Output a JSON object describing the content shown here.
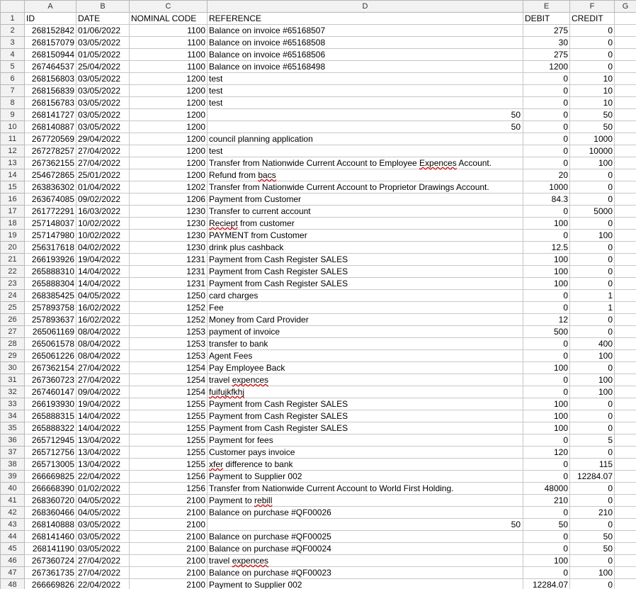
{
  "columns": [
    "A",
    "B",
    "C",
    "D",
    "E",
    "F",
    "G"
  ],
  "headers": {
    "id": "ID",
    "date": "DATE",
    "code": "NOMINAL CODE",
    "ref": "REFERENCE",
    "debit": "DEBIT",
    "credit": "CREDIT"
  },
  "rows": [
    {
      "n": "2",
      "id": "268152842",
      "date": "01/06/2022",
      "code": "1100",
      "ref": "Balance on invoice #65168507",
      "debit": "275",
      "credit": "0"
    },
    {
      "n": "3",
      "id": "268157079",
      "date": "03/05/2022",
      "code": "1100",
      "ref": "Balance on invoice #65168508",
      "debit": "30",
      "credit": "0"
    },
    {
      "n": "4",
      "id": "268150944",
      "date": "01/05/2022",
      "code": "1100",
      "ref": "Balance on invoice #65168506",
      "debit": "275",
      "credit": "0"
    },
    {
      "n": "5",
      "id": "267464537",
      "date": "25/04/2022",
      "code": "1100",
      "ref": "Balance on invoice #65168498",
      "debit": "1200",
      "credit": "0"
    },
    {
      "n": "6",
      "id": "268156803",
      "date": "03/05/2022",
      "code": "1200",
      "ref": "test",
      "debit": "0",
      "credit": "10"
    },
    {
      "n": "7",
      "id": "268156839",
      "date": "03/05/2022",
      "code": "1200",
      "ref": "test",
      "debit": "0",
      "credit": "10"
    },
    {
      "n": "8",
      "id": "268156783",
      "date": "03/05/2022",
      "code": "1200",
      "ref": "test",
      "debit": "0",
      "credit": "10"
    },
    {
      "n": "9",
      "id": "268141727",
      "date": "03/05/2022",
      "code": "1200",
      "ref": "",
      "refnum": "50",
      "debit": "0",
      "credit": "50"
    },
    {
      "n": "10",
      "id": "268140887",
      "date": "03/05/2022",
      "code": "1200",
      "ref": "",
      "refnum": "50",
      "debit": "0",
      "credit": "50"
    },
    {
      "n": "11",
      "id": "267720569",
      "date": "29/04/2022",
      "code": "1200",
      "ref": "council planning application",
      "debit": "0",
      "credit": "1000"
    },
    {
      "n": "12",
      "id": "267278257",
      "date": "27/04/2022",
      "code": "1200",
      "ref": "test",
      "debit": "0",
      "credit": "10000"
    },
    {
      "n": "13",
      "id": "267362155",
      "date": "27/04/2022",
      "code": "1200",
      "ref_pre": "Transfer from Nationwide Current Account to Employee ",
      "ref_err": "Expences",
      "ref_post": " Account.",
      "debit": "0",
      "credit": "100"
    },
    {
      "n": "14",
      "id": "254672865",
      "date": "25/01/2022",
      "code": "1200",
      "ref_pre": "Refund from ",
      "ref_err": "bacs",
      "ref_post": "",
      "debit": "20",
      "credit": "0"
    },
    {
      "n": "15",
      "id": "263836302",
      "date": "01/04/2022",
      "code": "1202",
      "ref": "Transfer from Nationwide Current Account to Proprietor Drawings Account.",
      "debit": "1000",
      "credit": "0"
    },
    {
      "n": "16",
      "id": "263674085",
      "date": "09/02/2022",
      "code": "1206",
      "ref": "Payment from Customer",
      "debit": "84.3",
      "credit": "0"
    },
    {
      "n": "17",
      "id": "261772291",
      "date": "16/03/2022",
      "code": "1230",
      "ref": "Transfer to current account",
      "debit": "0",
      "credit": "5000"
    },
    {
      "n": "18",
      "id": "257148037",
      "date": "10/02/2022",
      "code": "1230",
      "ref_pre": "",
      "ref_err": "Reciept",
      "ref_post": " from customer",
      "debit": "100",
      "credit": "0"
    },
    {
      "n": "19",
      "id": "257147980",
      "date": "10/02/2022",
      "code": "1230",
      "ref": "PAYMENT from Customer",
      "debit": "0",
      "credit": "100"
    },
    {
      "n": "20",
      "id": "256317618",
      "date": "04/02/2022",
      "code": "1230",
      "ref": "drink plus cashback",
      "debit": "12.5",
      "credit": "0"
    },
    {
      "n": "21",
      "id": "266193926",
      "date": "19/04/2022",
      "code": "1231",
      "ref": "Payment from Cash Register SALES",
      "debit": "100",
      "credit": "0"
    },
    {
      "n": "22",
      "id": "265888310",
      "date": "14/04/2022",
      "code": "1231",
      "ref": "Payment from Cash Register SALES",
      "debit": "100",
      "credit": "0"
    },
    {
      "n": "23",
      "id": "265888304",
      "date": "14/04/2022",
      "code": "1231",
      "ref": "Payment from Cash Register SALES",
      "debit": "100",
      "credit": "0"
    },
    {
      "n": "24",
      "id": "268385425",
      "date": "04/05/2022",
      "code": "1250",
      "ref": "card charges",
      "debit": "0",
      "credit": "1"
    },
    {
      "n": "25",
      "id": "257893758",
      "date": "16/02/2022",
      "code": "1252",
      "ref": "Fee",
      "debit": "0",
      "credit": "1"
    },
    {
      "n": "26",
      "id": "257893637",
      "date": "16/02/2022",
      "code": "1252",
      "ref": "Money from Card Provider",
      "debit": "12",
      "credit": "0"
    },
    {
      "n": "27",
      "id": "265061169",
      "date": "08/04/2022",
      "code": "1253",
      "ref": "payment of invoice",
      "debit": "500",
      "credit": "0"
    },
    {
      "n": "28",
      "id": "265061578",
      "date": "08/04/2022",
      "code": "1253",
      "ref": "transfer to bank",
      "debit": "0",
      "credit": "400"
    },
    {
      "n": "29",
      "id": "265061226",
      "date": "08/04/2022",
      "code": "1253",
      "ref": "Agent Fees",
      "debit": "0",
      "credit": "100"
    },
    {
      "n": "30",
      "id": "267362154",
      "date": "27/04/2022",
      "code": "1254",
      "ref": "Pay Employee Back",
      "debit": "100",
      "credit": "0"
    },
    {
      "n": "31",
      "id": "267360723",
      "date": "27/04/2022",
      "code": "1254",
      "ref_pre": "travel ",
      "ref_err": "expences",
      "ref_post": "",
      "debit": "0",
      "credit": "100"
    },
    {
      "n": "32",
      "id": "267460147",
      "date": "09/04/2022",
      "code": "1254",
      "ref_pre": "",
      "ref_err": "fuifujkfkhj",
      "ref_post": "",
      "debit": "0",
      "credit": "100"
    },
    {
      "n": "33",
      "id": "266193930",
      "date": "19/04/2022",
      "code": "1255",
      "ref": "Payment from Cash Register SALES",
      "debit": "100",
      "credit": "0"
    },
    {
      "n": "34",
      "id": "265888315",
      "date": "14/04/2022",
      "code": "1255",
      "ref": "Payment from Cash Register SALES",
      "debit": "100",
      "credit": "0"
    },
    {
      "n": "35",
      "id": "265888322",
      "date": "14/04/2022",
      "code": "1255",
      "ref": "Payment from Cash Register SALES",
      "debit": "100",
      "credit": "0"
    },
    {
      "n": "36",
      "id": "265712945",
      "date": "13/04/2022",
      "code": "1255",
      "ref": "Payment for fees",
      "debit": "0",
      "credit": "5"
    },
    {
      "n": "37",
      "id": "265712756",
      "date": "13/04/2022",
      "code": "1255",
      "ref": "Customer pays invoice",
      "debit": "120",
      "credit": "0"
    },
    {
      "n": "38",
      "id": "265713005",
      "date": "13/04/2022",
      "code": "1255",
      "ref_pre": "",
      "ref_err": "xfer",
      "ref_post": " difference to bank",
      "debit": "0",
      "credit": "115"
    },
    {
      "n": "39",
      "id": "266669825",
      "date": "22/04/2022",
      "code": "1256",
      "ref": "Payment to Supplier 002",
      "debit": "0",
      "credit": "12284.07"
    },
    {
      "n": "40",
      "id": "266668390",
      "date": "01/02/2022",
      "code": "1256",
      "ref": "Transfer from Nationwide Current Account to World First Holding.",
      "debit": "48000",
      "credit": "0"
    },
    {
      "n": "41",
      "id": "268360720",
      "date": "04/05/2022",
      "code": "2100",
      "ref_pre": "Payment to ",
      "ref_err": "rebill",
      "ref_post": "",
      "debit": "210",
      "credit": "0"
    },
    {
      "n": "42",
      "id": "268360466",
      "date": "04/05/2022",
      "code": "2100",
      "ref": "Balance on purchase #QF00026",
      "debit": "0",
      "credit": "210"
    },
    {
      "n": "43",
      "id": "268140888",
      "date": "03/05/2022",
      "code": "2100",
      "ref": "",
      "refnum": "50",
      "debit": "50",
      "credit": "0"
    },
    {
      "n": "44",
      "id": "268141460",
      "date": "03/05/2022",
      "code": "2100",
      "ref": "Balance on purchase #QF00025",
      "debit": "0",
      "credit": "50"
    },
    {
      "n": "45",
      "id": "268141190",
      "date": "03/05/2022",
      "code": "2100",
      "ref": "Balance on purchase #QF00024",
      "debit": "0",
      "credit": "50"
    },
    {
      "n": "46",
      "id": "267360724",
      "date": "27/04/2022",
      "code": "2100",
      "ref_pre": "travel ",
      "ref_err": "expences",
      "ref_post": "",
      "debit": "100",
      "credit": "0"
    },
    {
      "n": "47",
      "id": "267361735",
      "date": "27/04/2022",
      "code": "2100",
      "ref": "Balance on purchase #QF00023",
      "debit": "0",
      "credit": "100"
    },
    {
      "n": "48",
      "id": "266669826",
      "date": "22/04/2022",
      "code": "2100",
      "ref": "Payment to Supplier 002",
      "debit": "12284.07",
      "credit": "0"
    }
  ]
}
